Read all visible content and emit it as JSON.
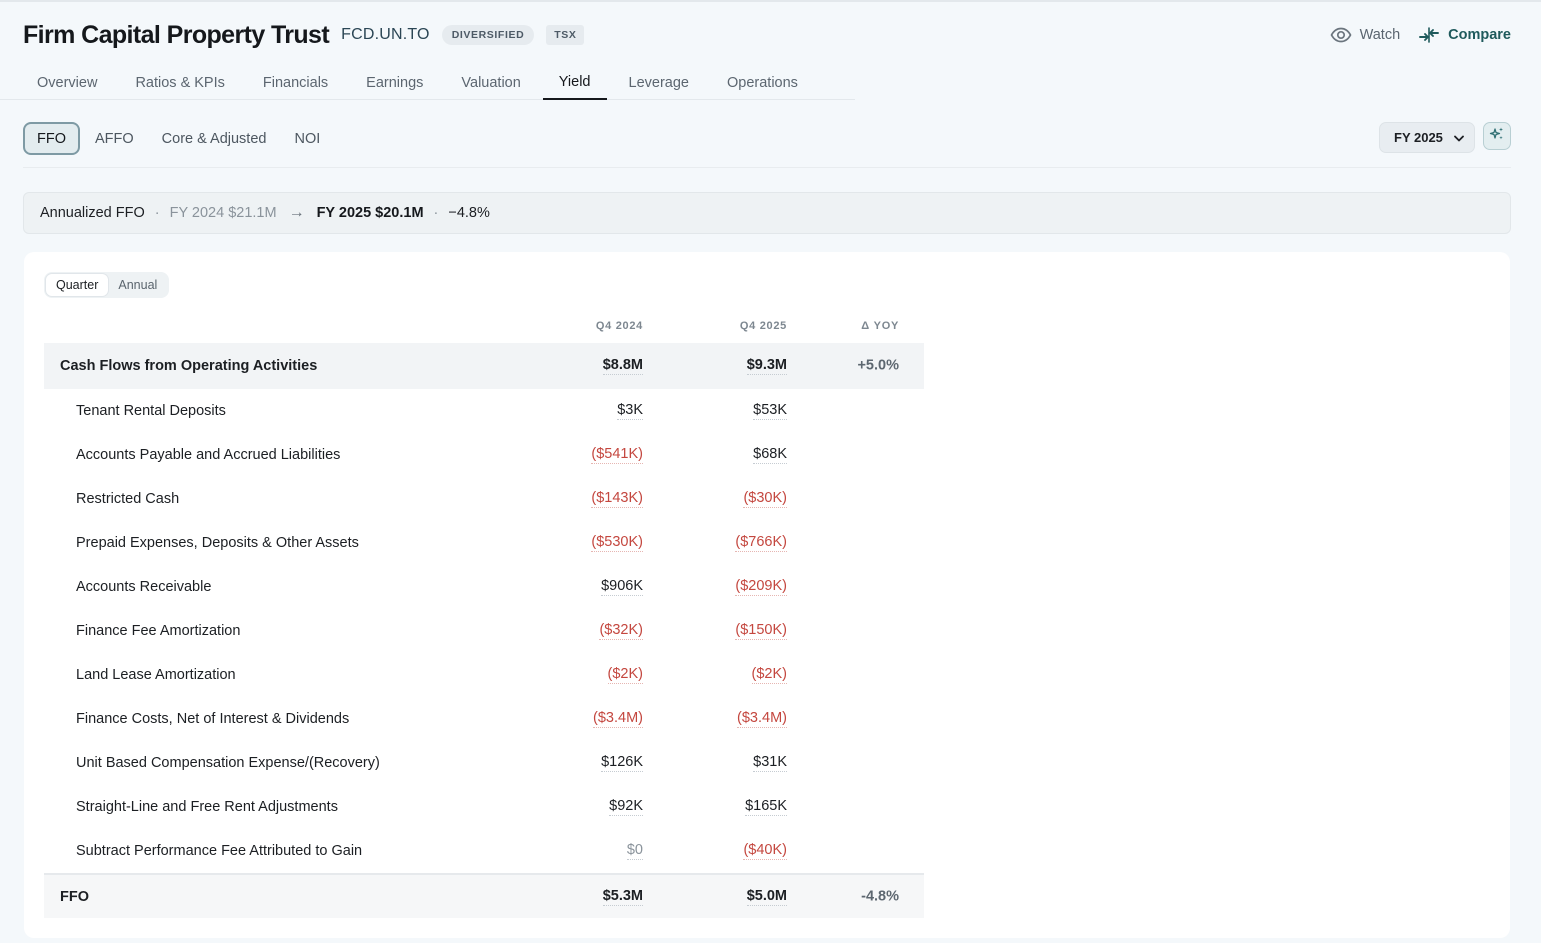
{
  "header": {
    "company": "Firm Capital Property Trust",
    "ticker": "FCD.UN.TO",
    "badges": [
      "DIVERSIFIED",
      "TSX"
    ],
    "watch_label": "Watch",
    "compare_label": "Compare"
  },
  "tabs": [
    {
      "label": "Overview"
    },
    {
      "label": "Ratios & KPIs"
    },
    {
      "label": "Financials"
    },
    {
      "label": "Earnings"
    },
    {
      "label": "Valuation"
    },
    {
      "label": "Yield",
      "active": true
    },
    {
      "label": "Leverage"
    },
    {
      "label": "Operations"
    }
  ],
  "subtabs": [
    {
      "label": "FFO",
      "active": true
    },
    {
      "label": "AFFO"
    },
    {
      "label": "Core & Adjusted"
    },
    {
      "label": "NOI"
    }
  ],
  "period_select": {
    "value": "FY 2025"
  },
  "summary": {
    "label": "Annualized FFO",
    "previous": "FY 2024 $21.1M",
    "arrow": "→",
    "current": "FY 2025 $20.1M",
    "change": "−4.8%"
  },
  "view_toggle": {
    "quarter": "Quarter",
    "annual": "Annual",
    "selected": "Quarter"
  },
  "table": {
    "columns": [
      "Q4 2024",
      "Q4 2025",
      "Δ YOY"
    ],
    "section": {
      "label": "Cash Flows from Operating Activities",
      "q4_2024": "$8.8M",
      "q4_2025": "$9.3M",
      "yoy": "+5.0%"
    },
    "rows": [
      {
        "label": "Tenant Rental Deposits",
        "q4_2024": "$3K",
        "q4_2025": "$53K"
      },
      {
        "label": "Accounts Payable and Accrued Liabilities",
        "q4_2024": "($541K)",
        "q4_2025": "$68K"
      },
      {
        "label": "Restricted Cash",
        "q4_2024": "($143K)",
        "q4_2025": "($30K)"
      },
      {
        "label": "Prepaid Expenses, Deposits & Other Assets",
        "q4_2024": "($530K)",
        "q4_2025": "($766K)"
      },
      {
        "label": "Accounts Receivable",
        "q4_2024": "$906K",
        "q4_2025": "($209K)"
      },
      {
        "label": "Finance Fee Amortization",
        "q4_2024": "($32K)",
        "q4_2025": "($150K)"
      },
      {
        "label": "Land Lease Amortization",
        "q4_2024": "($2K)",
        "q4_2025": "($2K)"
      },
      {
        "label": "Finance Costs, Net of Interest & Dividends",
        "q4_2024": "($3.4M)",
        "q4_2025": "($3.4M)"
      },
      {
        "label": "Unit Based Compensation Expense/(Recovery)",
        "q4_2024": "$126K",
        "q4_2025": "$31K"
      },
      {
        "label": "Straight-Line and Free Rent Adjustments",
        "q4_2024": "$92K",
        "q4_2025": "$165K"
      },
      {
        "label": "Subtract Performance Fee Attributed to Gain",
        "q4_2024": "$0",
        "q4_2025": "($40K)"
      }
    ],
    "total": {
      "label": "FFO",
      "q4_2024": "$5.3M",
      "q4_2025": "$5.0M",
      "yoy": "-4.8%"
    }
  },
  "colors": {
    "negative": "#c4473f",
    "accent": "#1f5a5c"
  }
}
